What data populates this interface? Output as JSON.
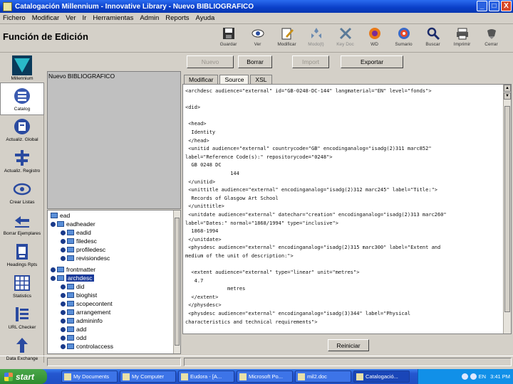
{
  "window": {
    "title": "Catalogación Millennium - Innovative Library - Nuevo BIBLIOGRAFICO",
    "controls": [
      "_",
      "□",
      "X"
    ]
  },
  "menu": [
    "Fichero",
    "Modificar",
    "Ver",
    "Ir",
    "Herramientas",
    "Admin",
    "Reports",
    "Ayuda"
  ],
  "page_title": "Función de Edición",
  "toolbar": [
    {
      "label": "Guardar",
      "icon": "save-icon",
      "enabled": true
    },
    {
      "label": "Ver",
      "icon": "eye-icon",
      "enabled": true
    },
    {
      "label": "Modificar",
      "icon": "edit-icon",
      "enabled": true
    },
    {
      "label": "Modo(t)",
      "icon": "mode-icon",
      "enabled": false
    },
    {
      "label": "Key Doc",
      "icon": "key-icon",
      "enabled": false
    },
    {
      "label": "WD",
      "icon": "globe-icon",
      "enabled": true
    },
    {
      "label": "Sumario",
      "icon": "summary-icon",
      "enabled": true
    },
    {
      "label": "Buscar",
      "icon": "search-icon",
      "enabled": true
    },
    {
      "label": "Imprimir",
      "icon": "printer-icon",
      "enabled": true
    },
    {
      "label": "Cerrar",
      "icon": "close-icon",
      "enabled": true
    }
  ],
  "actions": [
    {
      "label": "Nuevo",
      "enabled": false
    },
    {
      "label": "Borrar",
      "enabled": true
    },
    {
      "label": "Import",
      "enabled": false
    },
    {
      "label": "Exportar",
      "enabled": true
    }
  ],
  "sidebar": [
    {
      "label": "Millennium",
      "icon": "millennium-logo-icon"
    },
    {
      "label": "Catalog",
      "icon": "catalog-icon"
    },
    {
      "label": "Actualiz. Global",
      "icon": "global-update-icon"
    },
    {
      "label": "Actualiz. Registro",
      "icon": "record-update-icon"
    },
    {
      "label": "Crear Listas",
      "icon": "create-lists-icon"
    },
    {
      "label": "Borrar Ejemplares",
      "icon": "delete-items-icon"
    },
    {
      "label": "Headings Rpts",
      "icon": "headings-icon"
    },
    {
      "label": "Statistics",
      "icon": "statistics-icon"
    },
    {
      "label": "URL Checker",
      "icon": "url-checker-icon"
    },
    {
      "label": "Data Exchange",
      "icon": "data-exchange-icon"
    }
  ],
  "record_label": "Nuevo BIBLIOGRAFICO",
  "tree": [
    {
      "label": "ead",
      "indent": 0
    },
    {
      "label": "eadheader",
      "indent": 1
    },
    {
      "label": "eadid",
      "indent": 2
    },
    {
      "label": "filedesc",
      "indent": 2
    },
    {
      "label": "profiledesc",
      "indent": 2
    },
    {
      "label": "revisiondesc",
      "indent": 2
    },
    {
      "label": "frontmatter",
      "indent": 1
    },
    {
      "label": "archdesc",
      "indent": 1,
      "selected": true
    },
    {
      "label": "did",
      "indent": 2
    },
    {
      "label": "bioghist",
      "indent": 2
    },
    {
      "label": "scopecontent",
      "indent": 2
    },
    {
      "label": "arrangement",
      "indent": 2
    },
    {
      "label": "admininfo",
      "indent": 2
    },
    {
      "label": "add",
      "indent": 2
    },
    {
      "label": "odd",
      "indent": 2
    },
    {
      "label": "controlaccess",
      "indent": 2
    }
  ],
  "tabs": [
    "Modificar",
    "Source",
    "XSL"
  ],
  "active_tab": "Source",
  "source_lines": [
    "<archdesc audience=\"external\" id=\"GB-0248-DC-144\" langmaterial=\"EN\" level=\"fonds\">",
    "",
    "<did>",
    "",
    " <head>",
    "  Identity",
    " </head>",
    " <unitid audience=\"external\" countrycode=\"GB\" encodinganalog=\"isadg(2)311 marc852\"",
    "label=\"Reference Code(s):\" repositorycode=\"0248\">",
    "  GB 0248 DC",
    "               144",
    " </unitid>",
    " <unittitle audience=\"external\" encodinganalog=\"isadg(2)312 marc245\" label=\"Title:\">",
    "  Records of Glasgow Art School",
    " </unittitle>",
    " <unitdate audience=\"external\" datechar=\"creation\" encodinganalog=\"isadg(2)313 marc260\"",
    "label=\"Dates:\" normal=\"1868/1994\" type=\"inclusive\">",
    "  1868-1994",
    " </unitdate>",
    " <physdesc audience=\"external\" encodinganalog=\"isadg(2)315 marc300\" label=\"Extent and",
    "medium of the unit of description:\">",
    "",
    "  <extent audience=\"external\" type=\"linear\" unit=\"metres\">",
    "   4.7",
    "              metres",
    "  </extent>",
    " </physdesc>",
    " <physdesc audience=\"external\" encodinganalog=\"isadg(3)344\" label=\"Physical",
    "characteristics and technical requirements\">"
  ],
  "reinit_label": "Reiniciar",
  "taskbar": {
    "start_label": "start",
    "tasks": [
      {
        "label": "My Documents",
        "active": false
      },
      {
        "label": "My Computer",
        "active": false
      },
      {
        "label": "Eudora - [A...",
        "active": false
      },
      {
        "label": "Microsoft Po...",
        "active": false
      },
      {
        "label": "mil2.doc",
        "active": false
      },
      {
        "label": "Catalogació...",
        "active": true
      }
    ],
    "tray_lang": "EN",
    "clock": "3:41 PM"
  }
}
